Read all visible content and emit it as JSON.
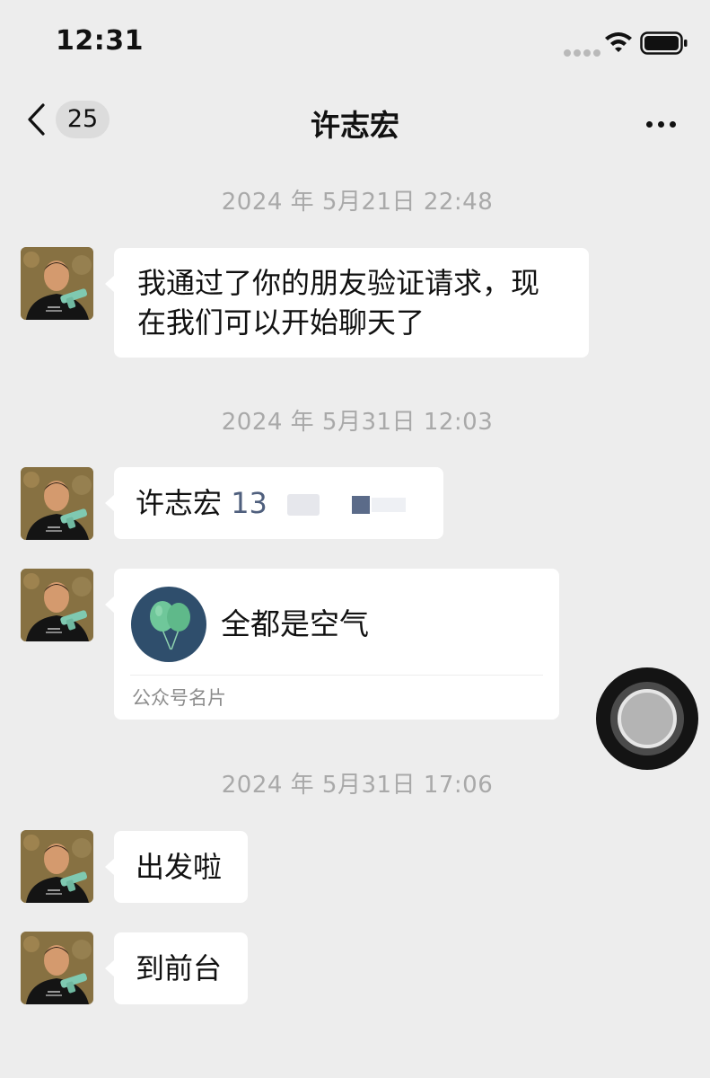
{
  "status_bar": {
    "time": "12:31",
    "icons": [
      "cellular-signal-icon",
      "wifi-icon",
      "battery-icon"
    ]
  },
  "nav": {
    "back_icon": "chevron-left-icon",
    "unread_count": "25",
    "title": "许志宏",
    "more_icon": "more-dots-icon"
  },
  "messages": [
    {
      "timestamp": "2024 年 5月21日 22:48"
    },
    {
      "line1": "我通过了你的朋友验证请求，现",
      "line2": "在我们可以开始聊天了"
    },
    {
      "timestamp": "2024 年 5月31日 12:03"
    },
    {
      "name": "许志宏",
      "phone_visible": "13"
    },
    {
      "card_name": "全都是空气",
      "card_type": "公众号名片",
      "card_icon": "balloons-icon"
    },
    {
      "timestamp": "2024 年 5月31日 17:06"
    },
    {
      "text": "出发啦"
    },
    {
      "text": "到前台"
    }
  ],
  "floating_button_icon": "assistive-touch-icon",
  "colors": {
    "background": "#ededed",
    "bubble": "#ffffff",
    "timestamp": "#a9a9a9",
    "phone_link": "#4f5f7d",
    "card_avatar_bg": "#2f4e6c",
    "balloon": "#6fc79a"
  }
}
